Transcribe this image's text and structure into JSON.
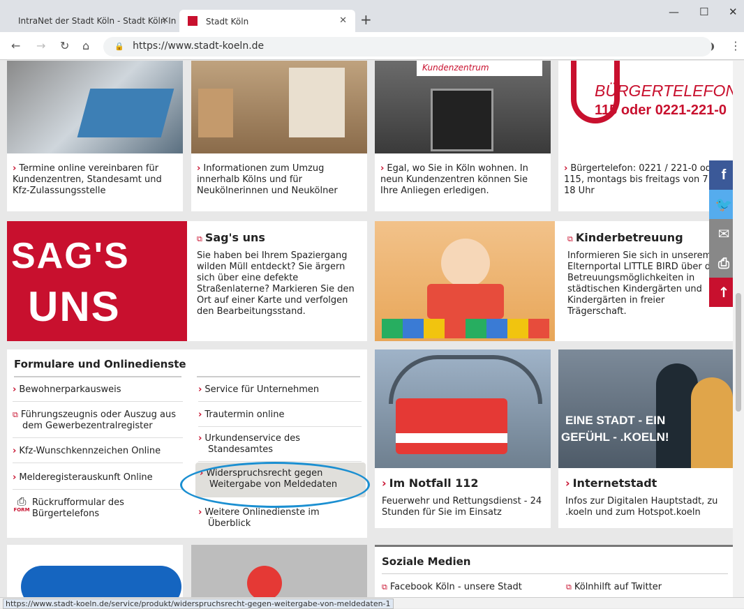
{
  "browser": {
    "tab1": "IntraNet der Stadt Köln - Stadt Köln In",
    "tab2": "Stadt Köln",
    "url": "https://www.stadt-koeln.de",
    "status_url": "https://www.stadt-koeln.de/service/produkt/widerspruchsrecht-gegen-weitergabe-von-meldedaten-1"
  },
  "top_cards": [
    {
      "text": "Termine online vereinbaren für Kundenzentren, Standesamt und Kfz-Zulassungsstelle"
    },
    {
      "text": "Informationen zum Umzug innerhalb Kölns und für Neukölnerinnen und Neukölner"
    },
    {
      "text": "Egal, wo Sie in Köln wohnen. In neun Kundenzentren können Sie Ihre Anliegen erledigen."
    },
    {
      "text": "Bürgertelefon: 0221 / 221-0 oder 115, montags bis freitags von 7 bis 18 Uhr"
    }
  ],
  "images": {
    "buergertelefon_title": "BÜRGERTELEFON",
    "buergertelefon_number": "115 oder 0221-221-0",
    "kundenzentrum_sign": "Kundenzentrum",
    "sags_uns_line1": "SAG'S",
    "sags_uns_line2": "UNS",
    "internetstadt_line1": "EINE STADT - EIN",
    "internetstadt_line2": "GEFÜHL - .KOELN!"
  },
  "sags_uns": {
    "title": "Sag's uns",
    "text": "Sie haben bei Ihrem Spaziergang wilden Müll entdeckt? Sie ärgern sich über eine defekte Straßenlaterne? Markieren Sie den Ort auf einer Karte und verfolgen den Bearbeitungsstand."
  },
  "kinderbetreuung": {
    "title": "Kinderbetreuung",
    "text": "Informieren Sie sich in unserem Elternportal LITTLE BIRD über die Betreuungsmöglichkeiten in städtischen Kindergärten und Kindergärten in freier Trägerschaft."
  },
  "formulare": {
    "heading": "Formulare und Onlinedienste",
    "left": [
      "Bewohnerparkausweis",
      "Führungszeugnis oder Auszug aus dem Gewerbezentralregister",
      "Kfz-Wunschkennzeichen Online",
      "Melderegisterauskunft Online",
      "Rückrufformular des Bürgertelefons"
    ],
    "right": [
      "Service für Unternehmen",
      "Trautermin online",
      "Urkundenservice des Standesamtes",
      "Widerspruchsrecht gegen Weitergabe von Meldedaten",
      "Weitere Onlinedienste im Überblick"
    ],
    "form_icon_label": "FORM"
  },
  "notfall": {
    "title": "Im Notfall 112",
    "text": "Feuerwehr und Rettungsdienst - 24 Stunden für Sie im Einsatz"
  },
  "internetstadt": {
    "title": "Internetstadt",
    "text": "Infos zur Digitalen Hauptstadt, zu .koeln und zum Hotspot.koeln"
  },
  "soziale_medien": {
    "heading": "Soziale Medien",
    "link1": "Facebook Köln - unsere Stadt",
    "link2": "Kölnhilft auf Twitter"
  },
  "colors": {
    "brand_red": "#c8102e",
    "highlight_blue": "#1b8fd1"
  }
}
